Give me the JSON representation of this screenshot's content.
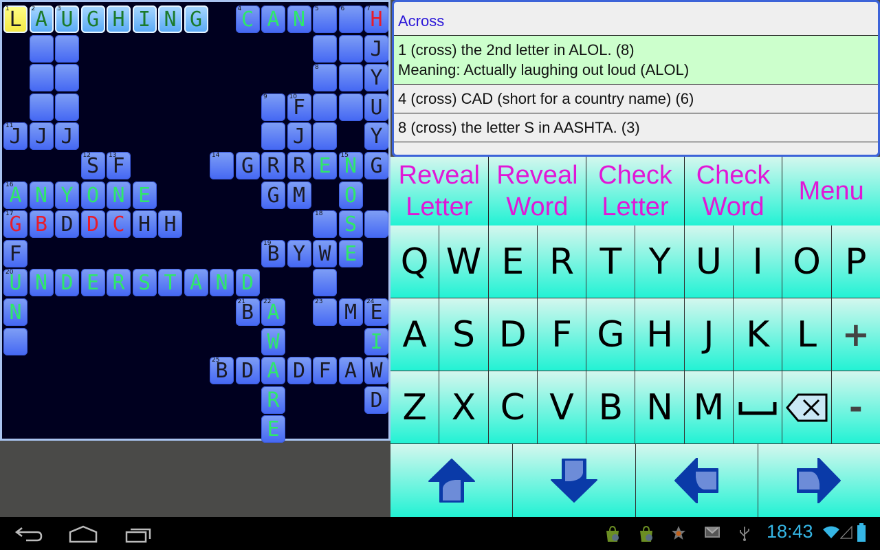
{
  "grid": {
    "cols": 15,
    "rows": 15,
    "cells": [
      {
        "r": 0,
        "c": 0,
        "n": "1",
        "l": "L",
        "s": "cursor"
      },
      {
        "r": 0,
        "c": 1,
        "n": "2",
        "l": "A",
        "s": "word"
      },
      {
        "r": 0,
        "c": 2,
        "n": "3",
        "l": "U",
        "s": "word"
      },
      {
        "r": 0,
        "c": 3,
        "l": "G",
        "s": "word"
      },
      {
        "r": 0,
        "c": 4,
        "l": "H",
        "s": "word"
      },
      {
        "r": 0,
        "c": 5,
        "l": "I",
        "s": "word"
      },
      {
        "r": 0,
        "c": 6,
        "l": "N",
        "s": "word"
      },
      {
        "r": 0,
        "c": 7,
        "l": "G",
        "s": "word"
      },
      {
        "r": 0,
        "c": 9,
        "n": "4",
        "l": "C",
        "col": "green"
      },
      {
        "r": 0,
        "c": 10,
        "l": "A",
        "col": "green"
      },
      {
        "r": 0,
        "c": 11,
        "l": "N",
        "col": "green"
      },
      {
        "r": 0,
        "c": 12,
        "n": "5",
        "l": ""
      },
      {
        "r": 0,
        "c": 13,
        "n": "6",
        "l": ""
      },
      {
        "r": 0,
        "c": 14,
        "n": "7",
        "l": "H",
        "col": "red"
      },
      {
        "r": 1,
        "c": 1,
        "l": ""
      },
      {
        "r": 1,
        "c": 2,
        "l": ""
      },
      {
        "r": 1,
        "c": 12,
        "l": ""
      },
      {
        "r": 1,
        "c": 13,
        "l": ""
      },
      {
        "r": 1,
        "c": 14,
        "l": "J"
      },
      {
        "r": 2,
        "c": 1,
        "l": ""
      },
      {
        "r": 2,
        "c": 2,
        "l": ""
      },
      {
        "r": 2,
        "c": 12,
        "n": "8",
        "l": ""
      },
      {
        "r": 2,
        "c": 13,
        "l": ""
      },
      {
        "r": 2,
        "c": 14,
        "l": "Y"
      },
      {
        "r": 3,
        "c": 1,
        "l": ""
      },
      {
        "r": 3,
        "c": 2,
        "l": ""
      },
      {
        "r": 3,
        "c": 10,
        "n": "9",
        "l": ""
      },
      {
        "r": 3,
        "c": 11,
        "n": "10",
        "l": "F"
      },
      {
        "r": 3,
        "c": 12,
        "l": ""
      },
      {
        "r": 3,
        "c": 13,
        "l": ""
      },
      {
        "r": 3,
        "c": 14,
        "l": "U"
      },
      {
        "r": 4,
        "c": 0,
        "n": "11",
        "l": "J"
      },
      {
        "r": 4,
        "c": 1,
        "l": "J"
      },
      {
        "r": 4,
        "c": 2,
        "l": "J"
      },
      {
        "r": 4,
        "c": 10,
        "l": ""
      },
      {
        "r": 4,
        "c": 11,
        "l": "J"
      },
      {
        "r": 4,
        "c": 12,
        "l": ""
      },
      {
        "r": 4,
        "c": 14,
        "l": "Y"
      },
      {
        "r": 5,
        "c": 3,
        "n": "12",
        "l": "S"
      },
      {
        "r": 5,
        "c": 4,
        "n": "13",
        "l": "F"
      },
      {
        "r": 5,
        "c": 8,
        "n": "14",
        "l": ""
      },
      {
        "r": 5,
        "c": 9,
        "l": "G"
      },
      {
        "r": 5,
        "c": 10,
        "l": "R"
      },
      {
        "r": 5,
        "c": 11,
        "l": "R"
      },
      {
        "r": 5,
        "c": 12,
        "l": "E",
        "col": "green"
      },
      {
        "r": 5,
        "c": 13,
        "n": "15",
        "l": "N",
        "col": "green"
      },
      {
        "r": 5,
        "c": 14,
        "l": "G"
      },
      {
        "r": 6,
        "c": 0,
        "n": "16",
        "l": "A",
        "col": "green"
      },
      {
        "r": 6,
        "c": 1,
        "l": "N",
        "col": "green"
      },
      {
        "r": 6,
        "c": 2,
        "l": "Y",
        "col": "green"
      },
      {
        "r": 6,
        "c": 3,
        "l": "O",
        "col": "green"
      },
      {
        "r": 6,
        "c": 4,
        "l": "N",
        "col": "green"
      },
      {
        "r": 6,
        "c": 5,
        "l": "E",
        "col": "green"
      },
      {
        "r": 6,
        "c": 10,
        "l": "G"
      },
      {
        "r": 6,
        "c": 11,
        "l": "M"
      },
      {
        "r": 6,
        "c": 13,
        "l": "O",
        "col": "green"
      },
      {
        "r": 7,
        "c": 0,
        "n": "17",
        "l": "G",
        "col": "red"
      },
      {
        "r": 7,
        "c": 1,
        "l": "B",
        "col": "red"
      },
      {
        "r": 7,
        "c": 2,
        "l": "D"
      },
      {
        "r": 7,
        "c": 3,
        "l": "D",
        "col": "red"
      },
      {
        "r": 7,
        "c": 4,
        "l": "C",
        "col": "red"
      },
      {
        "r": 7,
        "c": 5,
        "l": "H"
      },
      {
        "r": 7,
        "c": 6,
        "l": "H"
      },
      {
        "r": 7,
        "c": 12,
        "n": "18",
        "l": ""
      },
      {
        "r": 7,
        "c": 13,
        "l": "S",
        "col": "green"
      },
      {
        "r": 7,
        "c": 14,
        "l": ""
      },
      {
        "r": 8,
        "c": 0,
        "l": "F"
      },
      {
        "r": 8,
        "c": 10,
        "n": "19",
        "l": "B"
      },
      {
        "r": 8,
        "c": 11,
        "l": "Y"
      },
      {
        "r": 8,
        "c": 12,
        "l": "W"
      },
      {
        "r": 8,
        "c": 13,
        "l": "E",
        "col": "green"
      },
      {
        "r": 9,
        "c": 0,
        "n": "20",
        "l": "U",
        "col": "green"
      },
      {
        "r": 9,
        "c": 1,
        "l": "N",
        "col": "green"
      },
      {
        "r": 9,
        "c": 2,
        "l": "D",
        "col": "green"
      },
      {
        "r": 9,
        "c": 3,
        "l": "E",
        "col": "green"
      },
      {
        "r": 9,
        "c": 4,
        "l": "R",
        "col": "green"
      },
      {
        "r": 9,
        "c": 5,
        "l": "S",
        "col": "green"
      },
      {
        "r": 9,
        "c": 6,
        "l": "T",
        "col": "green"
      },
      {
        "r": 9,
        "c": 7,
        "l": "A",
        "col": "green"
      },
      {
        "r": 9,
        "c": 8,
        "l": "N",
        "col": "green"
      },
      {
        "r": 9,
        "c": 9,
        "l": "D",
        "col": "green"
      },
      {
        "r": 9,
        "c": 12,
        "l": ""
      },
      {
        "r": 10,
        "c": 0,
        "l": "N",
        "col": "green"
      },
      {
        "r": 10,
        "c": 9,
        "n": "21",
        "l": "B"
      },
      {
        "r": 10,
        "c": 10,
        "n": "22",
        "l": "A",
        "col": "green"
      },
      {
        "r": 10,
        "c": 12,
        "n": "23",
        "l": ""
      },
      {
        "r": 10,
        "c": 13,
        "l": "M"
      },
      {
        "r": 10,
        "c": 14,
        "n": "24",
        "l": "E"
      },
      {
        "r": 11,
        "c": 0,
        "l": ""
      },
      {
        "r": 11,
        "c": 10,
        "l": "W",
        "col": "green"
      },
      {
        "r": 11,
        "c": 14,
        "l": "I",
        "col": "green"
      },
      {
        "r": 12,
        "c": 8,
        "n": "25",
        "l": "B"
      },
      {
        "r": 12,
        "c": 9,
        "l": "D"
      },
      {
        "r": 12,
        "c": 10,
        "l": "A",
        "col": "green"
      },
      {
        "r": 12,
        "c": 11,
        "l": "D"
      },
      {
        "r": 12,
        "c": 12,
        "l": "F"
      },
      {
        "r": 12,
        "c": 13,
        "l": "A"
      },
      {
        "r": 12,
        "c": 14,
        "l": "W"
      },
      {
        "r": 13,
        "c": 10,
        "l": "R",
        "col": "green"
      },
      {
        "r": 13,
        "c": 14,
        "l": "D"
      },
      {
        "r": 14,
        "c": 10,
        "l": "E",
        "col": "green"
      }
    ]
  },
  "clues": {
    "header": "Across",
    "items": [
      {
        "line1": "1 (cross) the 2nd letter in ALOL. (8)",
        "line2": "Meaning: Actually laughing out loud (ALOL)",
        "active": true
      },
      {
        "line1": "4 (cross) CAD (short for a country name) (6)",
        "line2": "",
        "active": false
      },
      {
        "line1": "8 (cross) the letter S in AASHTA. (3)",
        "line2": "",
        "active": false
      }
    ]
  },
  "actions": [
    {
      "line1": "Reveal",
      "line2": "Letter",
      "name": "reveal-letter-button"
    },
    {
      "line1": "Reveal",
      "line2": "Word",
      "name": "reveal-word-button"
    },
    {
      "line1": "Check",
      "line2": "Letter",
      "name": "check-letter-button"
    },
    {
      "line1": "Check",
      "line2": "Word",
      "name": "check-word-button"
    },
    {
      "line1": "Menu",
      "line2": "",
      "name": "menu-button"
    }
  ],
  "keyboard": {
    "rows": [
      [
        "Q",
        "W",
        "E",
        "R",
        "T",
        "Y",
        "U",
        "I",
        "O",
        "P"
      ],
      [
        "A",
        "S",
        "D",
        "F",
        "G",
        "H",
        "J",
        "K",
        "L",
        "+"
      ],
      [
        "Z",
        "X",
        "C",
        "V",
        "B",
        "N",
        "M",
        "space",
        "backspace",
        "-"
      ]
    ]
  },
  "arrows": [
    "up",
    "down",
    "left",
    "right"
  ],
  "status": {
    "time": "18:43",
    "icons": [
      "market-update-icon",
      "market-update-icon",
      "star-icon",
      "gmail-icon",
      "usb-icon",
      "wifi-icon",
      "signal-icon",
      "battery-icon"
    ]
  },
  "colors": {
    "accent_magenta": "#e018d6",
    "key_bg": "#22f2d4",
    "grid_bg": "#00001f",
    "cell_blue": "#4467f3",
    "clue_active": "#ccffcc",
    "time_blue": "#35b6e5"
  }
}
